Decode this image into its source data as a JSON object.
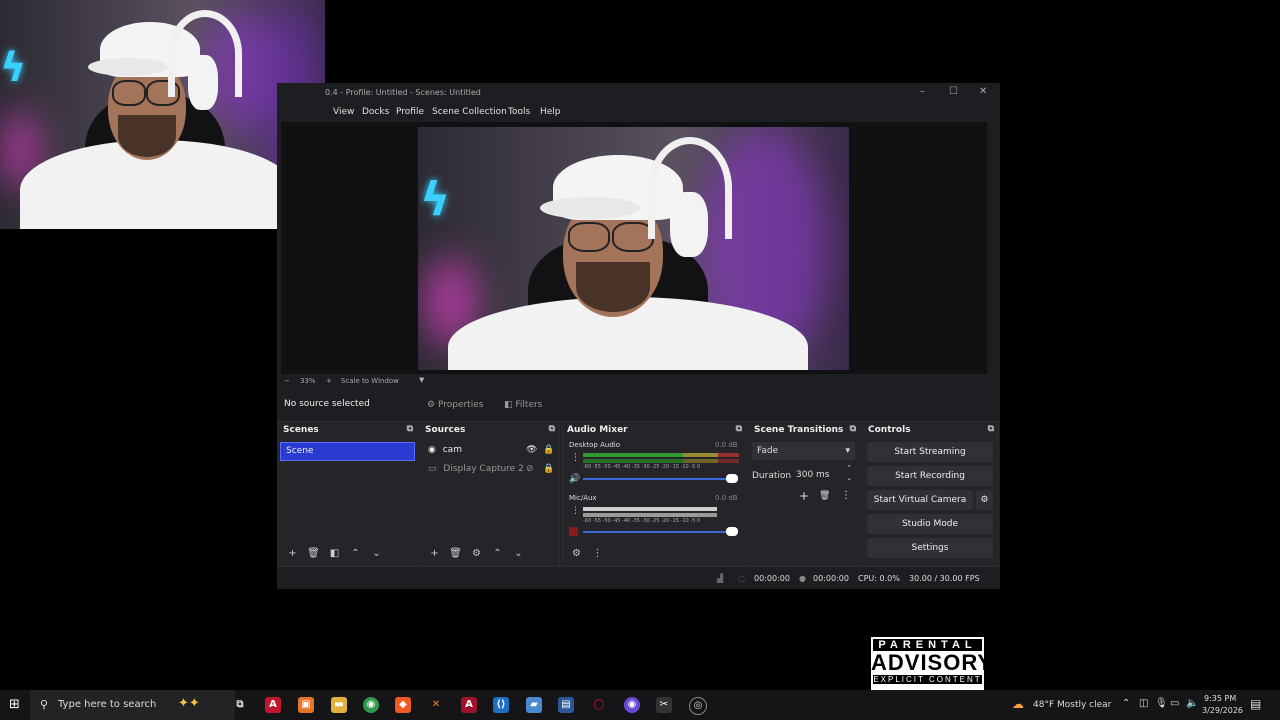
{
  "obs": {
    "title": "0.4 - Profile: Untitled - Scenes: Untitled",
    "menu": [
      "View",
      "Docks",
      "Profile",
      "Scene Collection",
      "Tools",
      "Help"
    ],
    "zoom": {
      "minus": "−",
      "value": "33%",
      "plus": "+",
      "mode": "Scale to Window"
    },
    "no_source": "No source selected",
    "properties_label": "Properties",
    "filters_label": "Filters",
    "scenes": {
      "title": "Scenes",
      "items": [
        "Scene"
      ]
    },
    "sources": {
      "title": "Sources",
      "items": [
        "cam",
        "Display Capture 2"
      ]
    },
    "mixer": {
      "title": "Audio Mixer",
      "channels": [
        {
          "name": "Desktop Audio",
          "db": "0.0 dB"
        },
        {
          "name": "Mic/Aux",
          "db": "0.0 dB"
        }
      ],
      "scale": "-60 -55 -50 -45 -40 -35 -30 -25 -20 -15 -10 -5 0"
    },
    "transitions": {
      "title": "Scene Transitions",
      "selected": "Fade",
      "duration_label": "Duration",
      "duration_value": "300 ms"
    },
    "controls": {
      "title": "Controls",
      "buttons": [
        "Start Streaming",
        "Start Recording",
        "Start Virtual Camera",
        "Studio Mode",
        "Settings"
      ]
    },
    "status": {
      "stream_time": "00:00:00",
      "rec_time": "00:00:00",
      "cpu": "CPU: 0.0%",
      "fps": "30.00 / 30.00 FPS"
    }
  },
  "advisory": {
    "line1": "PARENTAL",
    "line2": "ADVISORY",
    "line3": "EXPLICIT CONTENT"
  },
  "taskbar": {
    "search_placeholder": "Type here to search",
    "weather": "48°F  Mostly clear",
    "time": "9:35 PM",
    "date": "3/29/2026"
  },
  "colors": {
    "scene_selected": "#2a3bd1",
    "obs_bg": "#1e1e22",
    "meter_green": "#2f9a2f"
  }
}
